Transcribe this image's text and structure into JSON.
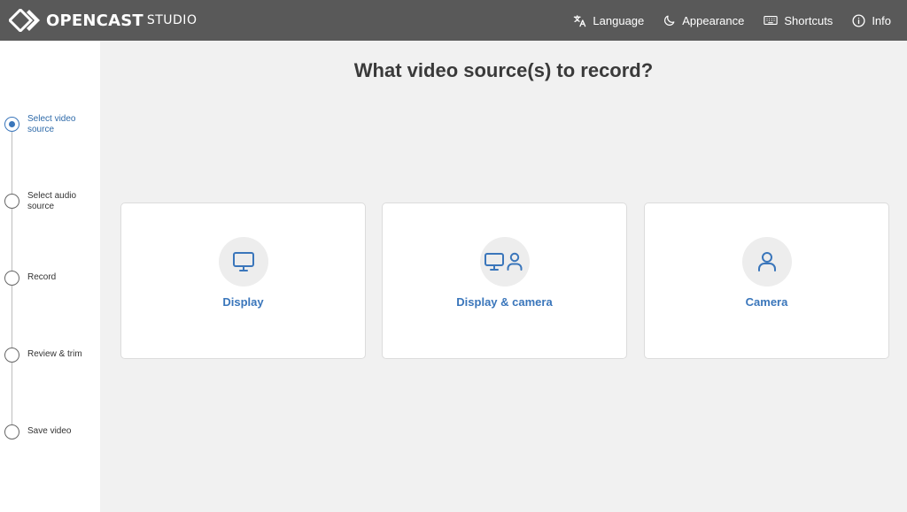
{
  "header": {
    "logo_text": "OPENCAST",
    "logo_sub": "STUDIO",
    "nav": [
      {
        "label": "Language",
        "icon": "translate-icon"
      },
      {
        "label": "Appearance",
        "icon": "moon-icon"
      },
      {
        "label": "Shortcuts",
        "icon": "keyboard-icon"
      },
      {
        "label": "Info",
        "icon": "info-icon"
      }
    ]
  },
  "steps": [
    {
      "label": "Select video source",
      "active": true
    },
    {
      "label": "Select audio source",
      "active": false
    },
    {
      "label": "Record",
      "active": false
    },
    {
      "label": "Review & trim",
      "active": false
    },
    {
      "label": "Save video",
      "active": false
    }
  ],
  "main": {
    "title": "What video source(s) to record?",
    "options": [
      {
        "label": "Display",
        "icon": "monitor-icon"
      },
      {
        "label": "Display & camera",
        "icon": "monitor-user-icon"
      },
      {
        "label": "Camera",
        "icon": "user-icon"
      }
    ]
  },
  "colors": {
    "header_bg": "#595959",
    "accent": "#3a76bb",
    "background": "#f1f1f1"
  }
}
